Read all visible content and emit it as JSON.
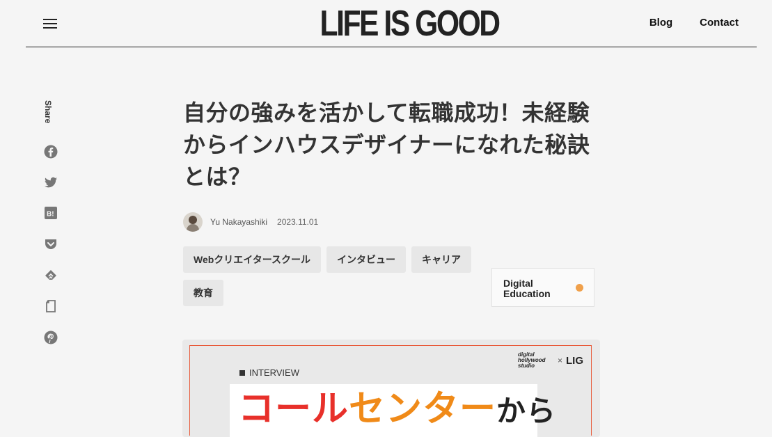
{
  "header": {
    "logo": "LIFE IS GOOD",
    "nav": [
      "Blog",
      "Contact"
    ]
  },
  "share": {
    "label": "Share",
    "icons": [
      "facebook-icon",
      "twitter-icon",
      "hatena-bookmark-icon",
      "pocket-icon",
      "feedly-icon",
      "evernote-icon",
      "pinterest-icon"
    ]
  },
  "article": {
    "title": "自分の強みを活かして転職成功！未経験からインハウスデザイナーになれた秘訣とは？",
    "author": "Yu Nakayashiki",
    "date": "2023.11.01",
    "tags": [
      "Webクリエイタースクール",
      "インタビュー",
      "キャリア",
      "教育"
    ],
    "badge": "Digital Education"
  },
  "hero": {
    "label": "INTERVIEW",
    "brand_left": "digital hollywood studio",
    "brand_sep": "×",
    "brand_right": "LIG",
    "headline_part1": "コール",
    "headline_part2": "センター",
    "headline_part3": "から"
  },
  "colors": {
    "accent_dot": "#f0a04b",
    "headline_red": "#e8302a",
    "headline_orange": "#f08a18"
  }
}
